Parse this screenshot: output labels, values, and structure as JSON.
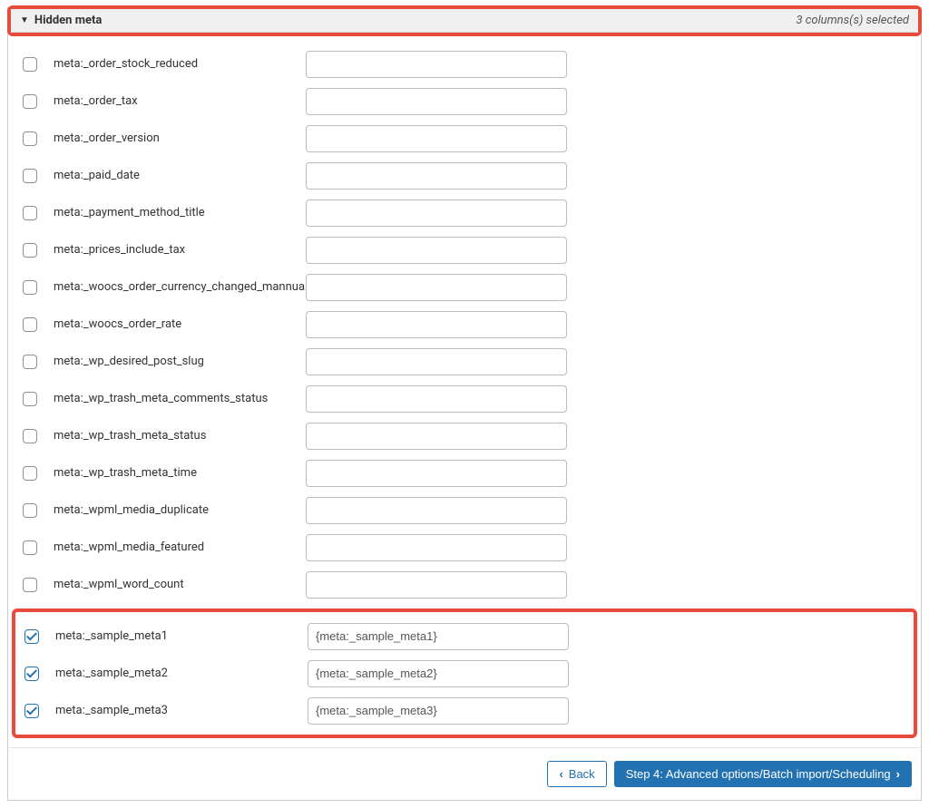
{
  "section": {
    "title": "Hidden meta",
    "selected_text": "3 columns(s) selected"
  },
  "rows": [
    {
      "label": "meta:_order_stock_reduced",
      "value": "",
      "checked": false
    },
    {
      "label": "meta:_order_tax",
      "value": "",
      "checked": false
    },
    {
      "label": "meta:_order_version",
      "value": "",
      "checked": false
    },
    {
      "label": "meta:_paid_date",
      "value": "",
      "checked": false
    },
    {
      "label": "meta:_payment_method_title",
      "value": "",
      "checked": false
    },
    {
      "label": "meta:_prices_include_tax",
      "value": "",
      "checked": false
    },
    {
      "label": "meta:_woocs_order_currency_changed_mannualy",
      "value": "",
      "checked": false
    },
    {
      "label": "meta:_woocs_order_rate",
      "value": "",
      "checked": false
    },
    {
      "label": "meta:_wp_desired_post_slug",
      "value": "",
      "checked": false
    },
    {
      "label": "meta:_wp_trash_meta_comments_status",
      "value": "",
      "checked": false
    },
    {
      "label": "meta:_wp_trash_meta_status",
      "value": "",
      "checked": false
    },
    {
      "label": "meta:_wp_trash_meta_time",
      "value": "",
      "checked": false
    },
    {
      "label": "meta:_wpml_media_duplicate",
      "value": "",
      "checked": false
    },
    {
      "label": "meta:_wpml_media_featured",
      "value": "",
      "checked": false
    },
    {
      "label": "meta:_wpml_word_count",
      "value": "",
      "checked": false
    }
  ],
  "highlighted_rows": [
    {
      "label": "meta:_sample_meta1",
      "value": "{meta:_sample_meta1}",
      "checked": true
    },
    {
      "label": "meta:_sample_meta2",
      "value": "{meta:_sample_meta2}",
      "checked": true
    },
    {
      "label": "meta:_sample_meta3",
      "value": "{meta:_sample_meta3}",
      "checked": true
    }
  ],
  "footer": {
    "back_label": "Back",
    "next_label": "Step 4: Advanced options/Batch import/Scheduling"
  }
}
